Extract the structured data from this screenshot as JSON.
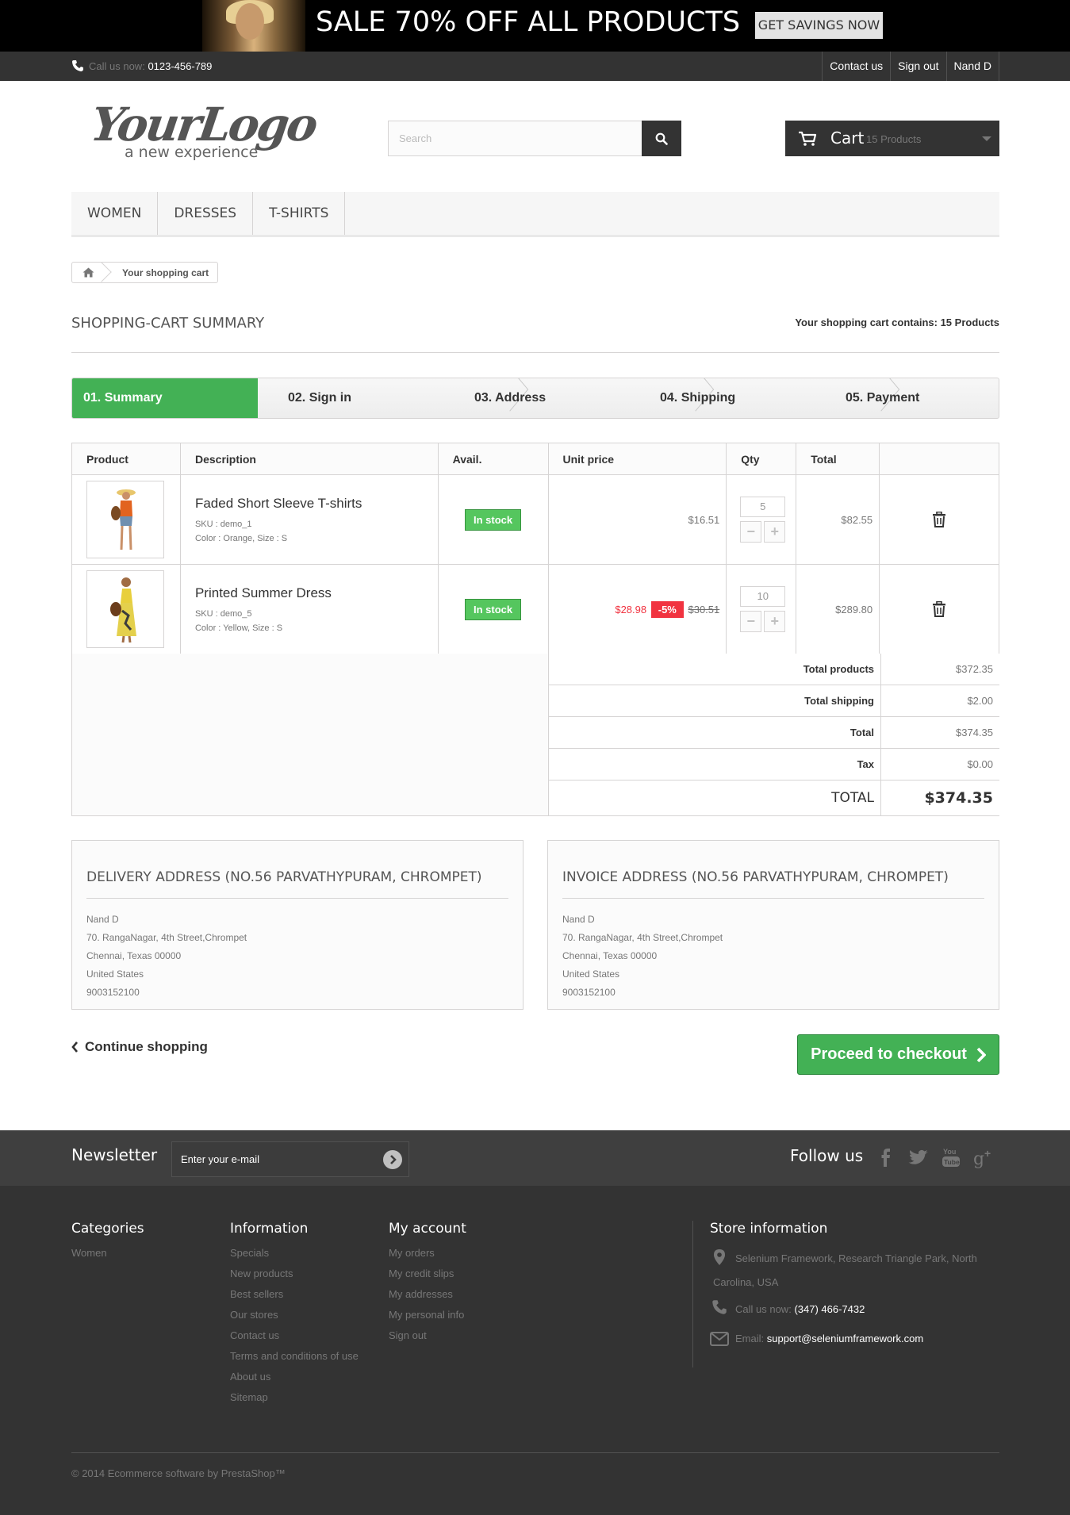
{
  "banner": {
    "sale_text": "SALE 70% OFF ALL PRODUCTS",
    "cta": "GET SAVINGS NOW"
  },
  "topbar": {
    "call_label": "Call us now:",
    "phone": "0123-456-789",
    "links": [
      "Contact us",
      "Sign out",
      "Nand D"
    ]
  },
  "logo": {
    "text": "YourLogo",
    "tagline": "a new experience"
  },
  "search": {
    "placeholder": "Search"
  },
  "cart": {
    "label": "Cart",
    "count": "15 Products"
  },
  "menu": [
    "WOMEN",
    "DRESSES",
    "T-SHIRTS"
  ],
  "breadcrumb": {
    "current": "Your shopping cart"
  },
  "page": {
    "title": "SHOPPING-CART SUMMARY",
    "contains_label": "Your shopping cart contains:",
    "contains_value": "15 Products"
  },
  "steps": [
    "01. Summary",
    "02. Sign in",
    "03. Address",
    "04. Shipping",
    "05. Payment"
  ],
  "table": {
    "headers": [
      "Product",
      "Description",
      "Avail.",
      "Unit price",
      "Qty",
      "Total"
    ],
    "rows": [
      {
        "name": "Faded Short Sleeve T-shirts",
        "sku": "SKU : demo_1",
        "color": "Color : Orange, Size : S",
        "avail": "In stock",
        "price": "$16.51",
        "qty": "5",
        "total": "$82.55"
      },
      {
        "name": "Printed Summer Dress",
        "sku": "SKU : demo_5",
        "color": "Color : Yellow, Size : S",
        "avail": "In stock",
        "price_new": "$28.98",
        "discount": "-5%",
        "price_old": "$30.51",
        "qty": "10",
        "total": "$289.80"
      }
    ]
  },
  "totals": [
    {
      "label": "Total products",
      "value": "$372.35"
    },
    {
      "label": "Total shipping",
      "value": "$2.00"
    },
    {
      "label": "Total",
      "value": "$374.35"
    },
    {
      "label": "Tax",
      "value": "$0.00"
    },
    {
      "label": "TOTAL",
      "value": "$374.35"
    }
  ],
  "delivery": {
    "title": "DELIVERY ADDRESS (NO.56 PARVATHYPURAM, CHROMPET)",
    "lines": [
      "Nand D",
      "70. RangaNagar, 4th Street,Chrompet",
      "Chennai, Texas 00000",
      "United States",
      "9003152100"
    ]
  },
  "invoice": {
    "title": "INVOICE ADDRESS (NO.56 PARVATHYPURAM, CHROMPET)",
    "lines": [
      "Nand D",
      "70. RangaNagar, 4th Street,Chrompet",
      "Chennai, Texas 00000",
      "United States",
      "9003152100"
    ]
  },
  "actions": {
    "continue": "Continue shopping",
    "checkout": "Proceed to checkout"
  },
  "newsletter": {
    "title": "Newsletter",
    "placeholder": "Enter your e-mail",
    "follow": "Follow us"
  },
  "footer": {
    "categories": {
      "title": "Categories",
      "items": [
        "Women"
      ]
    },
    "information": {
      "title": "Information",
      "items": [
        "Specials",
        "New products",
        "Best sellers",
        "Our stores",
        "Contact us",
        "Terms and conditions of use",
        "About us",
        "Sitemap"
      ]
    },
    "account": {
      "title": "My account",
      "items": [
        "My orders",
        "My credit slips",
        "My addresses",
        "My personal info",
        "Sign out"
      ]
    },
    "store": {
      "title": "Store information",
      "address": "Selenium Framework, Research Triangle Park, North Carolina, USA",
      "call_label": "Call us now:",
      "phone": "(347) 466-7432",
      "email_label": "Email:",
      "email": "support@seleniumframework.com"
    },
    "copyright": "© 2014 Ecommerce software by PrestaShop™"
  },
  "colors": {
    "green": "#43b155",
    "dark": "#333333",
    "sale_red": "#f13340"
  }
}
